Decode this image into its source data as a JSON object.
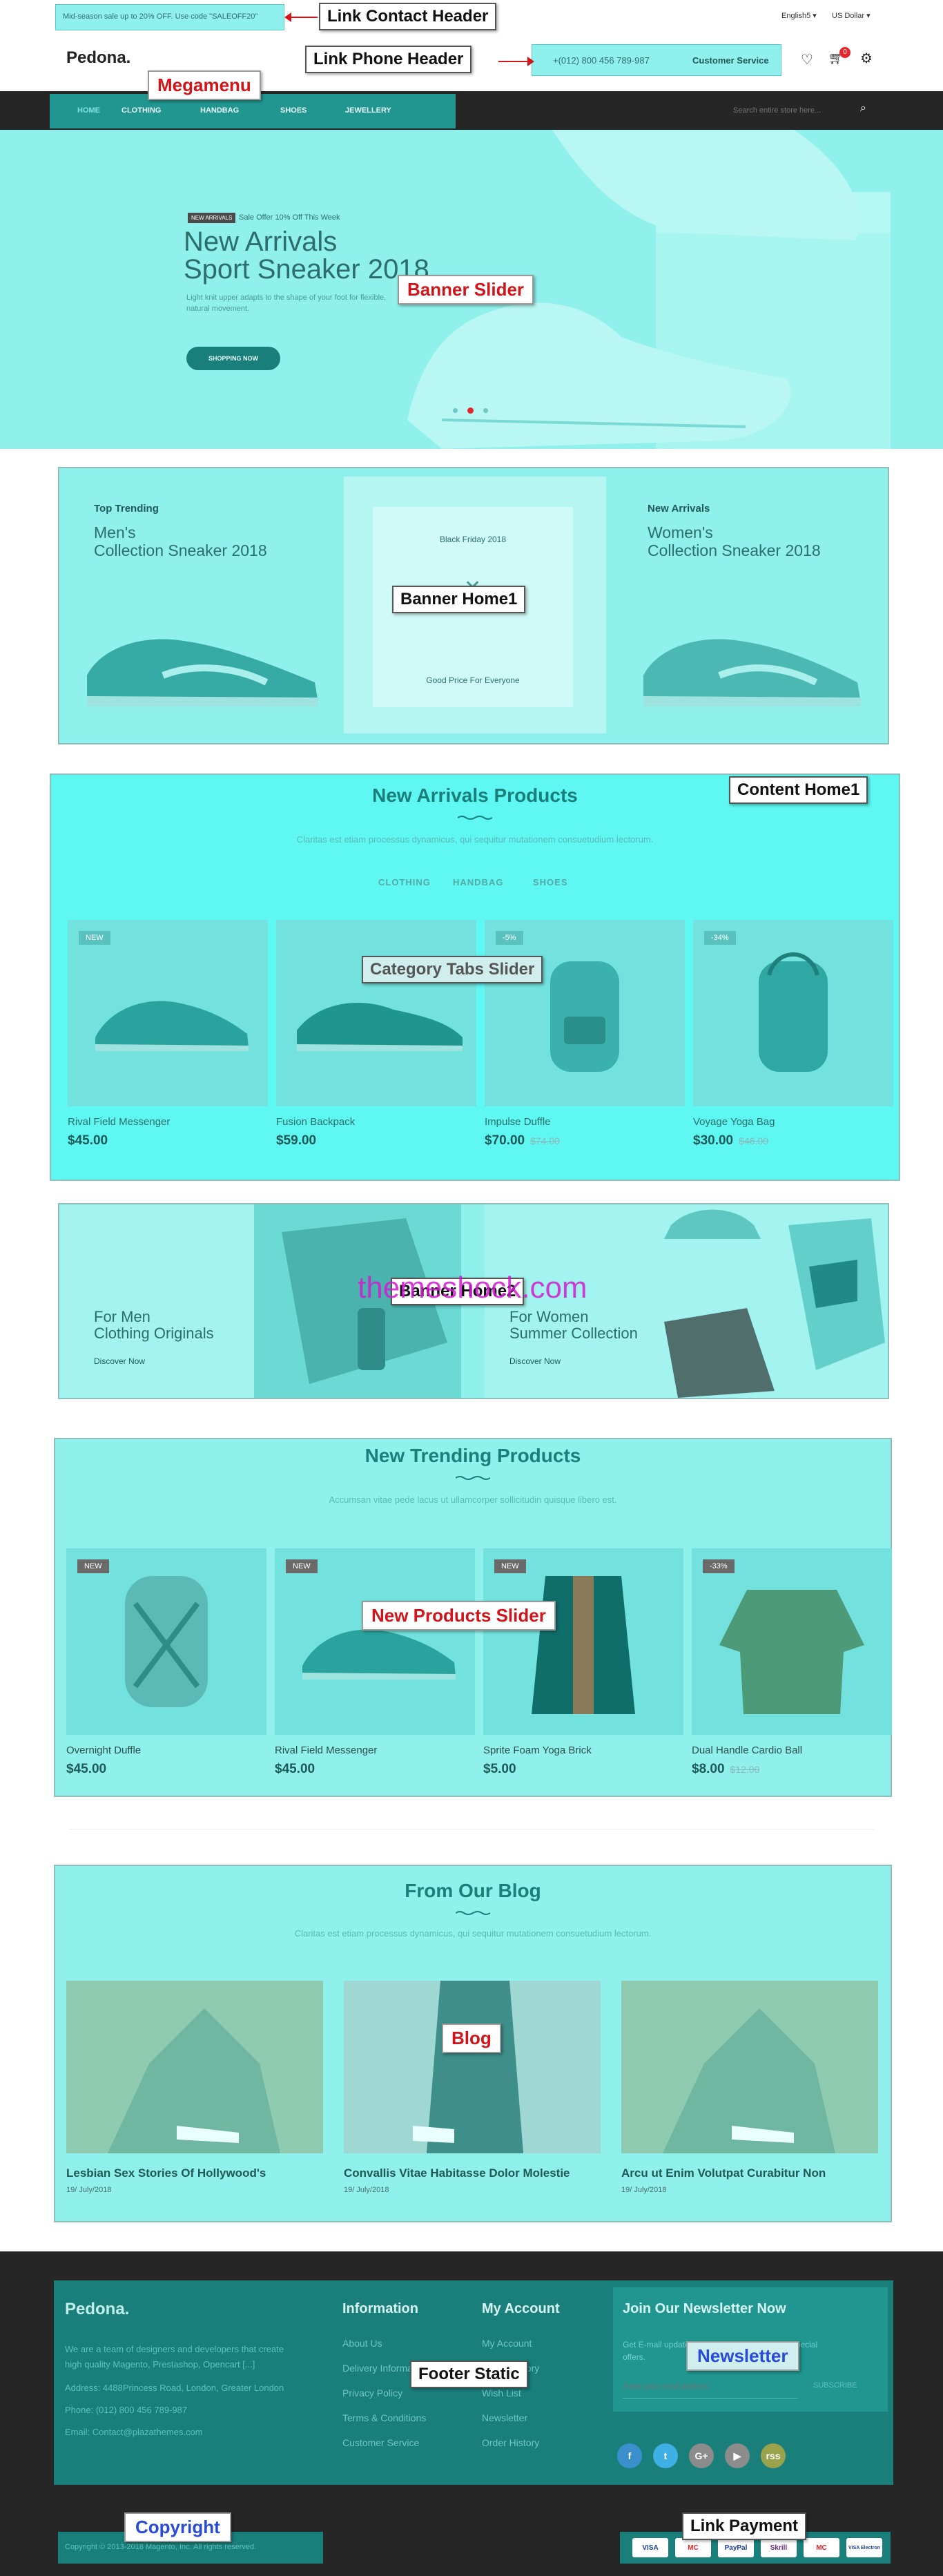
{
  "topbar": {
    "promo": "Mid-season sale up to 20% OFF. Use code \"SALEOFF20\"",
    "language": "English5",
    "currency": "US Dollar"
  },
  "header": {
    "logo": "Pedona.",
    "phone": "+(012) 800 456 789-987",
    "customer_service": "Customer Service",
    "cart_count": "0"
  },
  "nav": {
    "items": [
      "HOME",
      "CLOTHING",
      "HANDBAG",
      "SHOES",
      "JEWELLERY"
    ],
    "search_placeholder": "Search entire store here..."
  },
  "hero": {
    "tag": "NEW ARRIVALS",
    "offer": "Sale Offer 10% Off This Week",
    "title_line1": "New Arrivals",
    "title_line2": "Sport Sneaker 2018",
    "desc_line1": "Light knit upper adapts to the shape of your foot for flexible,",
    "desc_line2": "natural movement.",
    "button": "SHOPPING NOW"
  },
  "banner1": {
    "left_kicker": "Top Trending",
    "left_title1": "Men's",
    "left_title2": "Collection Sneaker 2018",
    "mid_top": "Black Friday 2018",
    "mid_bottom": "Good Price For Everyone",
    "right_kicker": "New Arrivals",
    "right_title1": "Women's",
    "right_title2": "Collection Sneaker 2018"
  },
  "new_arrivals": {
    "title": "New Arrivals Products",
    "subtitle": "Claritas est etiam processus dynamicus, qui sequitur mutationem consuetudium lectorum.",
    "tabs": [
      "CLOTHING",
      "HANDBAG",
      "SHOES"
    ],
    "products": [
      {
        "badge": "NEW",
        "name": "Rival Field Messenger",
        "price": "$45.00",
        "old": ""
      },
      {
        "badge": "",
        "name": "Fusion Backpack",
        "price": "$59.00",
        "old": ""
      },
      {
        "badge": "-5%",
        "name": "Impulse Duffle",
        "price": "$70.00",
        "old": "$74.00"
      },
      {
        "badge": "-34%",
        "name": "Voyage Yoga Bag",
        "price": "$30.00",
        "old": "$46.00"
      }
    ]
  },
  "banner2": {
    "left_kicker": "For Men",
    "left_title": "Clothing Originals",
    "left_link": "Discover Now",
    "right_kicker": "For Women",
    "right_title": "Summer Collection",
    "right_link": "Discover Now",
    "watermark": "themeshock.com"
  },
  "trending": {
    "title": "New Trending Products",
    "subtitle": "Accumsan vitae pede lacus ut ullamcorper sollicitudin quisque libero est.",
    "products": [
      {
        "badge": "NEW",
        "name": "Overnight Duffle",
        "price": "$45.00",
        "old": ""
      },
      {
        "badge": "NEW",
        "name": "Rival Field Messenger",
        "price": "$45.00",
        "old": ""
      },
      {
        "badge": "NEW",
        "name": "Sprite Foam Yoga Brick",
        "price": "$5.00",
        "old": ""
      },
      {
        "badge": "-33%",
        "name": "Dual Handle Cardio Ball",
        "price": "$8.00",
        "old": "$12.00"
      }
    ]
  },
  "blog": {
    "title": "From Our Blog",
    "subtitle": "Claritas est etiam processus dynamicus, qui sequitur mutationem consuetudium lectorum.",
    "posts": [
      {
        "title": "Lesbian Sex Stories Of Hollywood's",
        "date": "19/ July/2018"
      },
      {
        "title": "Convallis Vitae Habitasse Dolor Molestie",
        "date": "19/ July/2018"
      },
      {
        "title": "Arcu ut Enim Volutpat Curabitur Non",
        "date": "19/ July/2018"
      }
    ]
  },
  "footer": {
    "logo": "Pedona.",
    "about1": "We are a team of designers and developers that create",
    "about2": "high quality Magento, Prestashop, Opencart [...]",
    "address": "Address: 4488Princess Road, London, Greater London",
    "phone": "Phone: (012) 800 456 789-987",
    "email": "Email: Contact@plazathemes.com",
    "info_title": "Information",
    "info_links": [
      "About Us",
      "Delivery Information",
      "Privacy Policy",
      "Terms & Conditions",
      "Customer Service"
    ],
    "account_title": "My Account",
    "account_links": [
      "My Account",
      "Order History",
      "Wish List",
      "Newsletter",
      "Order History"
    ],
    "newsletter_title": "Join Our Newsletter Now",
    "newsletter_text1": "Get E-mail updates about our latest shop and special",
    "newsletter_text2": "offers.",
    "newsletter_placeholder": "Enter your email address",
    "newsletter_button": "SUBSCRIBE",
    "social": [
      "f",
      "t",
      "G+",
      "▶",
      "rss"
    ],
    "copyright": "Copyright © 2013-2018 Magento, Inc. All rights reserved.",
    "payments": [
      "VISA",
      "MC",
      "PayPal",
      "Skrill",
      "MC",
      "VISA Electron"
    ]
  },
  "annotations": {
    "link_contact_header": "Link Contact Header",
    "megamenu": "Megamenu",
    "link_phone_header": "Link Phone Header",
    "banner_slider": "Banner Slider",
    "banner_home1": "Banner Home1",
    "content_home1": "Content Home1",
    "category_tabs_slider": "Category Tabs Slider",
    "banner_home2": "Banner Home2",
    "new_products_slider": "New Products Slider",
    "blog": "Blog",
    "newsletter": "Newsletter",
    "footer_static": "Footer Static",
    "copyright": "Copyright",
    "link_payment": "Link Payment"
  }
}
